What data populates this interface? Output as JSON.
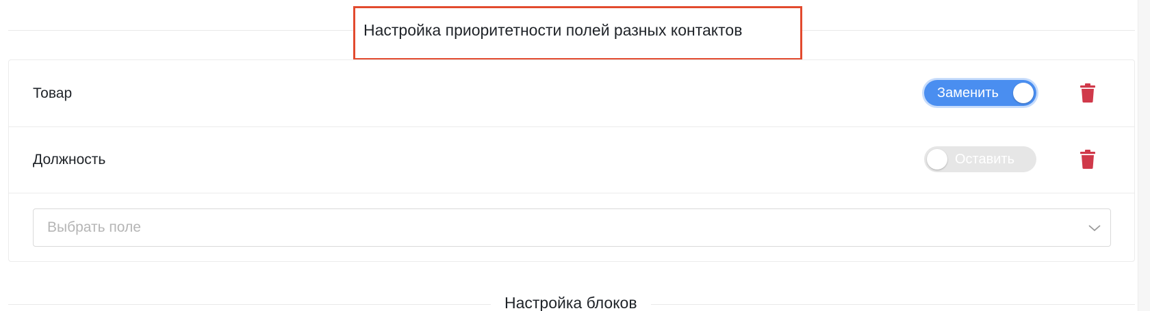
{
  "sections": {
    "main_title": "Настройка приоритетности полей разных контактов",
    "blocks_title": "Настройка блоков"
  },
  "fields": [
    {
      "label": "Товар",
      "toggle_label": "Заменить",
      "toggle_on": true
    },
    {
      "label": "Должность",
      "toggle_label": "Оставить",
      "toggle_on": false
    }
  ],
  "select": {
    "placeholder": "Выбрать поле"
  },
  "colors": {
    "highlight_border": "#e24a2e",
    "toggle_on": "#4a8ef0",
    "toggle_off": "#e6e6e6",
    "delete": "#d0394a"
  },
  "icons": {
    "delete": "trash-icon",
    "dropdown": "chevron-down-icon"
  }
}
